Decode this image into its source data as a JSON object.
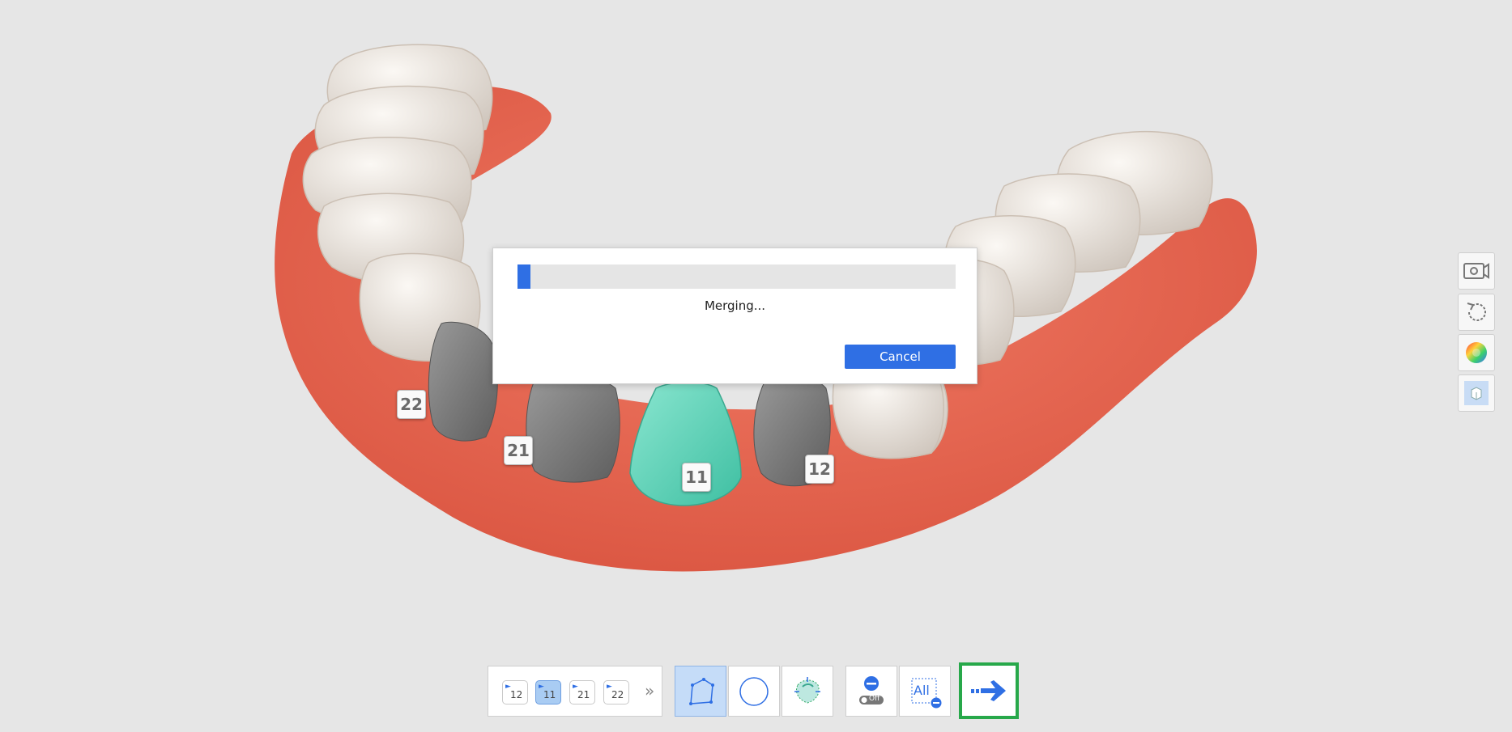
{
  "dialog": {
    "status": "Merging...",
    "cancel_label": "Cancel",
    "progress_fraction": 0.03
  },
  "tooth_labels": [
    "22",
    "21",
    "11",
    "12"
  ],
  "right_toolbar": {
    "icons": [
      "camera-icon",
      "rotate-icon",
      "color-wheel-icon",
      "cube-view-icon"
    ]
  },
  "bottom_toolbar": {
    "tooth_tabs": [
      "12",
      "11",
      "21",
      "22"
    ],
    "active_tab": "11",
    "more_label": "»",
    "tools": [
      "polygon-select-icon",
      "circle-select-icon",
      "smart-select-icon"
    ],
    "toggle_off_label": "Off",
    "all_label": "All"
  },
  "colors": {
    "accent": "#2f6fe4",
    "next_border": "#27a84a",
    "gum": "#e86a55",
    "tooth": "#ece6df",
    "prep_gray": "#7a7a7a",
    "prep_selected": "#5ed0b6"
  }
}
